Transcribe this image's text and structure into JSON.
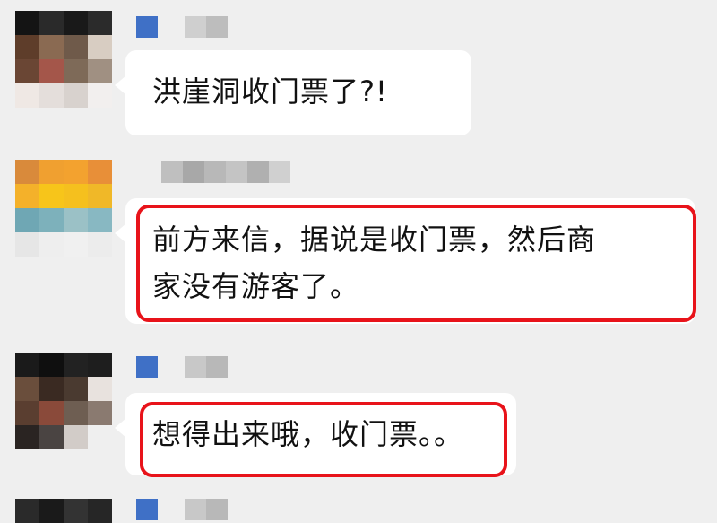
{
  "chat": {
    "messages": [
      {
        "text": "洪崖洞收门票了?!"
      },
      {
        "text": "前方来信，据说是收门票，然后商\n家没有游客了。"
      },
      {
        "text": "想得出来哦，收门票。。"
      }
    ]
  },
  "colors": {
    "highlight_border": "#e8131a",
    "bubble": "#ffffff",
    "background": "#efefef"
  }
}
